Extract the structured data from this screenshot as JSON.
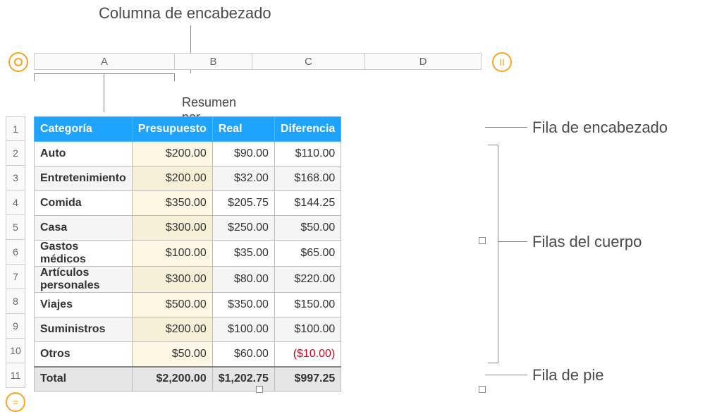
{
  "annotations": {
    "col_header": "Columna de encabezado",
    "row_header": "Fila de encabezado",
    "body_rows": "Filas del cuerpo",
    "footer_row": "Fila de pie"
  },
  "sheet": {
    "title": "Resumen por categoría",
    "col_letters": [
      "A",
      "B",
      "C",
      "D"
    ],
    "row_numbers": [
      "1",
      "2",
      "3",
      "4",
      "5",
      "6",
      "7",
      "8",
      "9",
      "10",
      "11"
    ],
    "headers": {
      "cat": "Categoría",
      "budget": "Presupuesto",
      "actual": "Real",
      "diff": "Diferencia"
    },
    "rows": [
      {
        "cat": "Auto",
        "budget": "$200.00",
        "actual": "$90.00",
        "diff": "$110.00"
      },
      {
        "cat": "Entretenimiento",
        "budget": "$200.00",
        "actual": "$32.00",
        "diff": "$168.00"
      },
      {
        "cat": "Comida",
        "budget": "$350.00",
        "actual": "$205.75",
        "diff": "$144.25"
      },
      {
        "cat": "Casa",
        "budget": "$300.00",
        "actual": "$250.00",
        "diff": "$50.00"
      },
      {
        "cat": "Gastos médicos",
        "budget": "$100.00",
        "actual": "$35.00",
        "diff": "$65.00"
      },
      {
        "cat": "Artículos personales",
        "budget": "$300.00",
        "actual": "$80.00",
        "diff": "$220.00"
      },
      {
        "cat": "Viajes",
        "budget": "$500.00",
        "actual": "$350.00",
        "diff": "$150.00"
      },
      {
        "cat": "Suministros",
        "budget": "$200.00",
        "actual": "$100.00",
        "diff": "$100.00"
      },
      {
        "cat": "Otros",
        "budget": "$50.00",
        "actual": "$60.00",
        "diff": "($10.00)",
        "neg": true
      }
    ],
    "footer": {
      "cat": "Total",
      "budget": "$2,200.00",
      "actual": "$1,202.75",
      "diff": "$997.25"
    },
    "buttons": {
      "pause": "II",
      "equals": "="
    }
  }
}
